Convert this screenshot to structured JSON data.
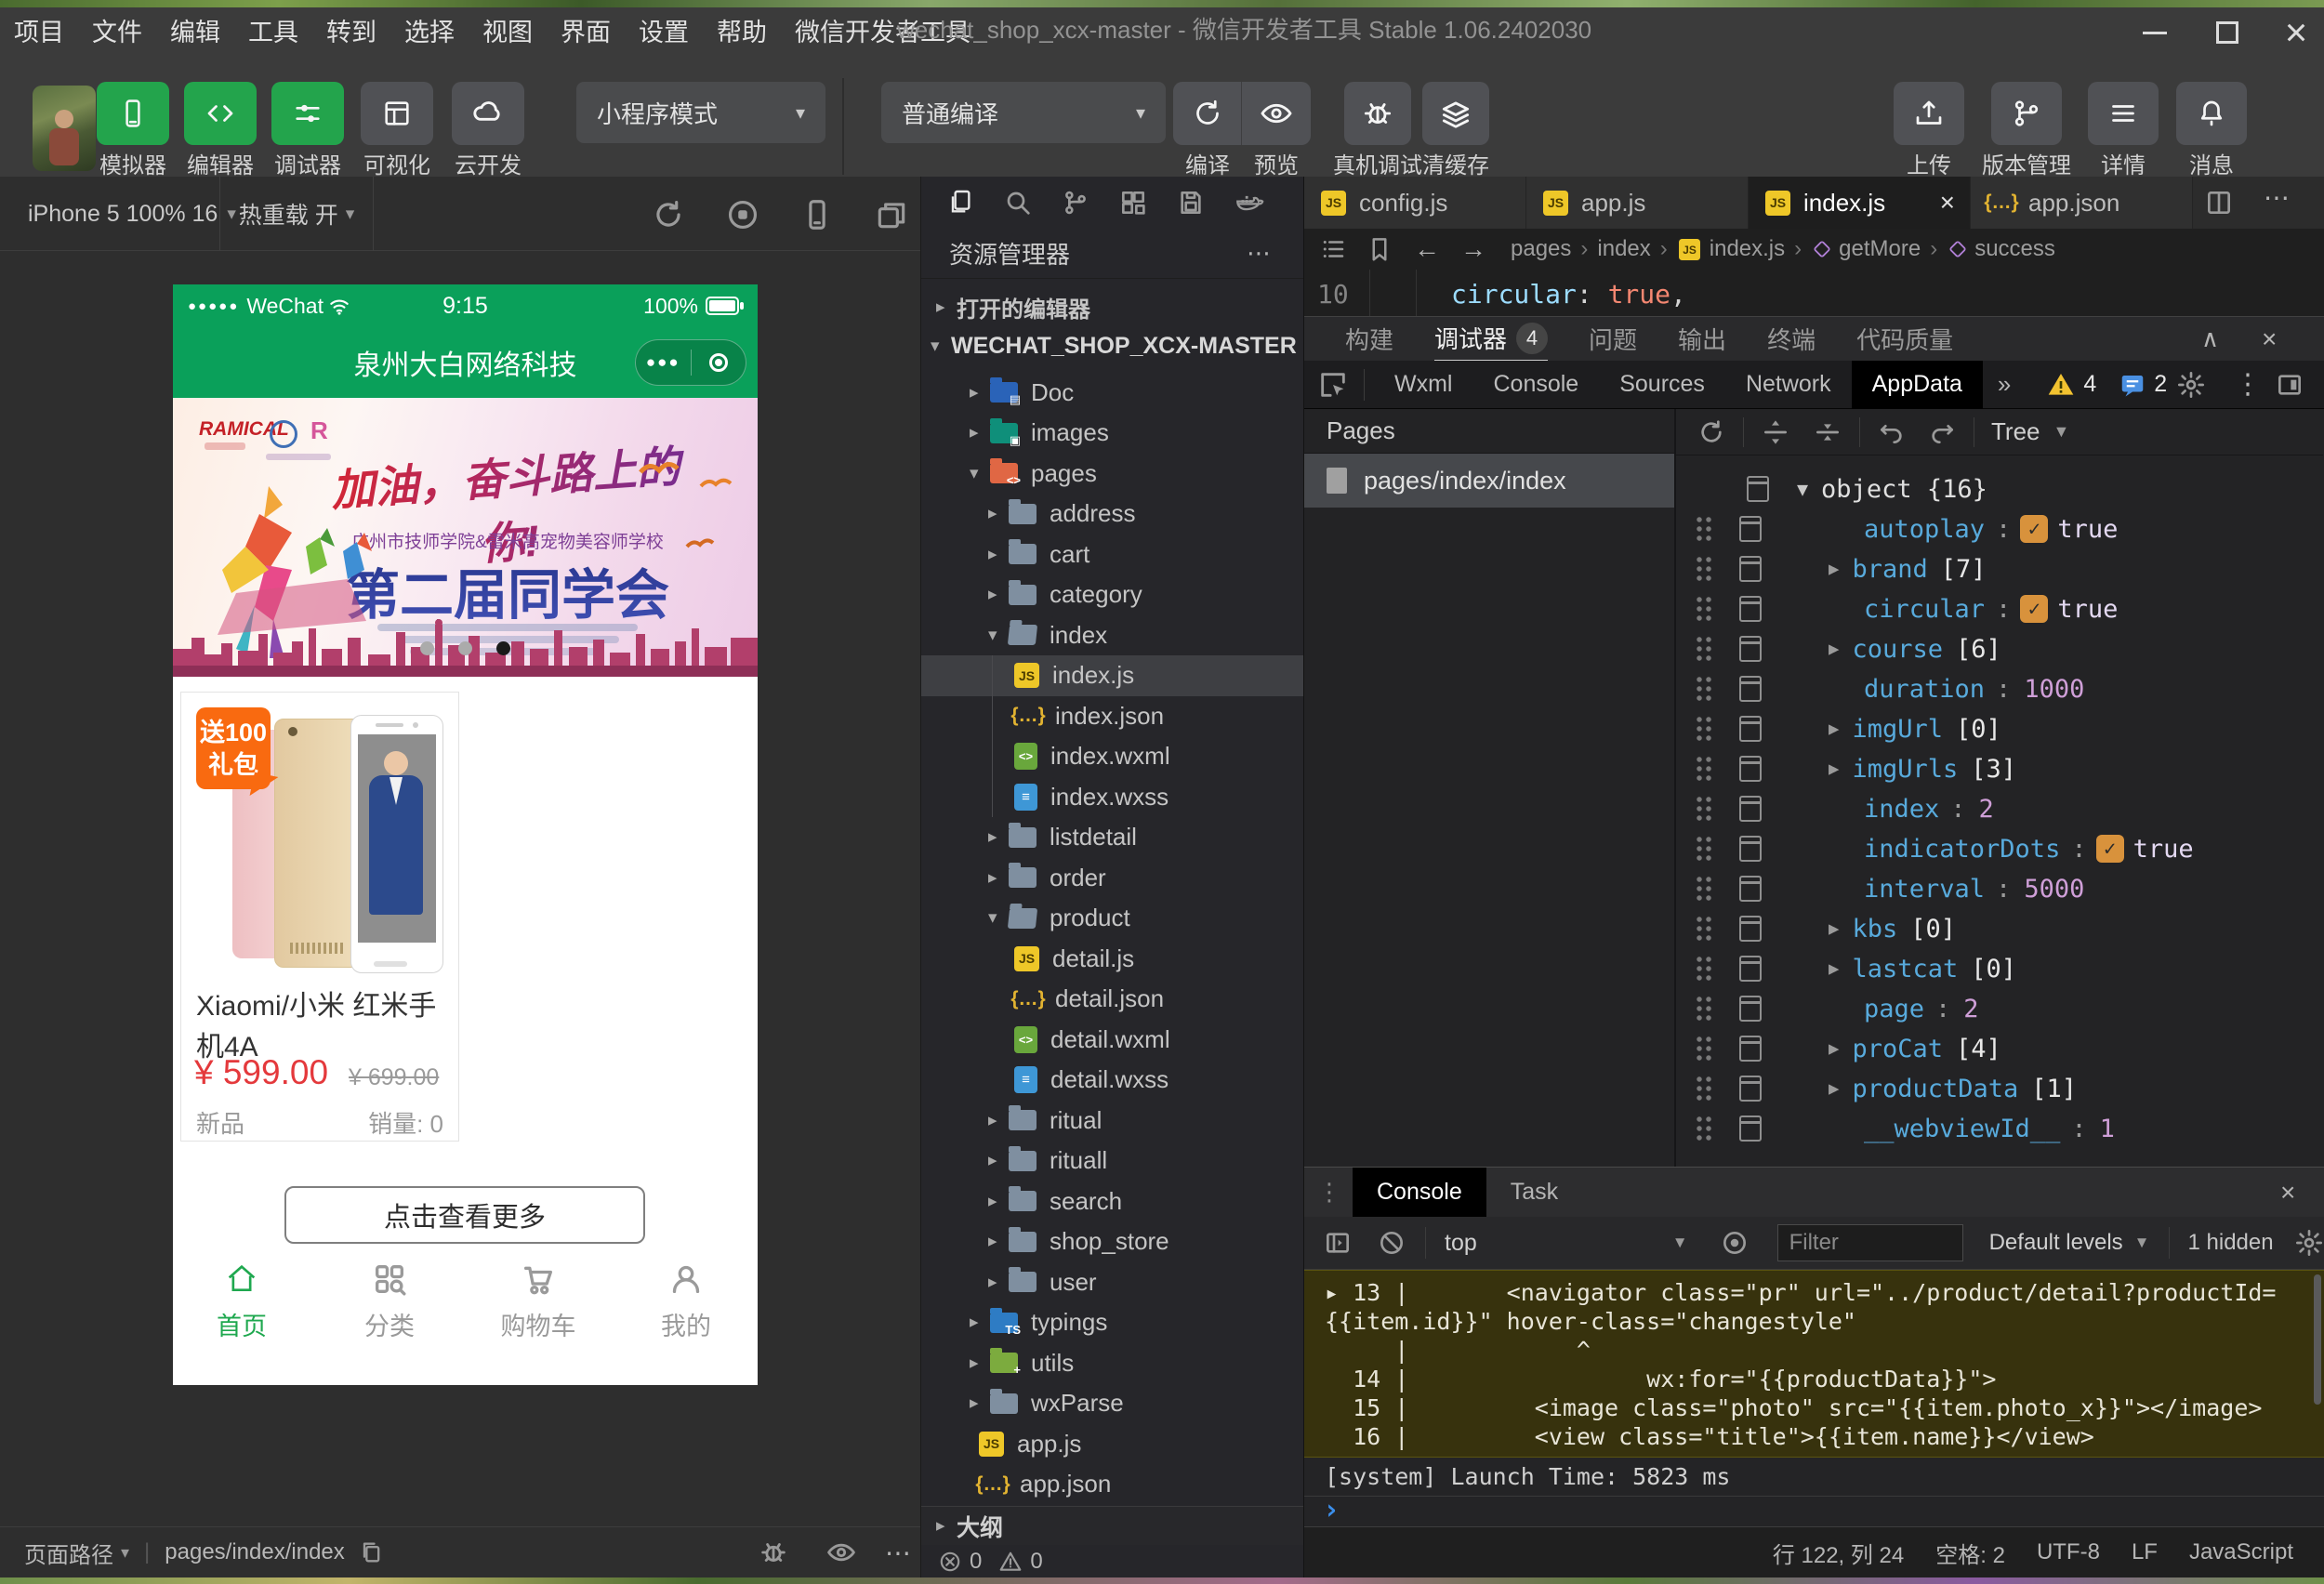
{
  "window": {
    "menu": [
      "项目",
      "文件",
      "编辑",
      "工具",
      "转到",
      "选择",
      "视图",
      "界面",
      "设置",
      "帮助",
      "微信开发者工具"
    ],
    "title": "wechat_shop_xcx-master - 微信开发者工具 Stable 1.06.2402030"
  },
  "toolbar": {
    "mode_buttons": [
      {
        "label": "模拟器",
        "icon": "phone-icon",
        "style": "green"
      },
      {
        "label": "编辑器",
        "icon": "code-icon",
        "style": "green"
      },
      {
        "label": "调试器",
        "icon": "sliders-icon",
        "style": "green"
      },
      {
        "label": "可视化",
        "icon": "layout-icon",
        "style": "gray"
      },
      {
        "label": "云开发",
        "icon": "cloud-icon",
        "style": "gray"
      }
    ],
    "mode_dropdown": "小程序模式",
    "compile_dropdown": "普通编译",
    "action_buttons": [
      {
        "label": "编译",
        "icon": "refresh-icon"
      },
      {
        "label": "预览",
        "icon": "eye-icon"
      },
      {
        "label": "真机调试",
        "icon": "bug-icon"
      },
      {
        "label": "清缓存",
        "icon": "layers-icon"
      }
    ],
    "right_buttons": [
      {
        "label": "上传",
        "icon": "upload-icon"
      },
      {
        "label": "版本管理",
        "icon": "branch-icon"
      },
      {
        "label": "详情",
        "icon": "menu-icon"
      },
      {
        "label": "消息",
        "icon": "bell-icon"
      }
    ]
  },
  "simulator": {
    "device": "iPhone 5 100% 16",
    "hot_reload": "热重载 开",
    "phone": {
      "status": {
        "carrier": "WeChat",
        "time": "9:15",
        "battery": "100%"
      },
      "title": "泉州大白网络科技",
      "banner": {
        "brand": "RAMICAL",
        "headline": "加油，奋斗路上的你!",
        "subtitle": "广州市技师学院&雷米高宠物美容师学校",
        "main_title": "第二届同学会",
        "dots": 3,
        "active_dot": 2
      },
      "product": {
        "badge": [
          "送100",
          "礼包"
        ],
        "name": "Xiaomi/小米 红米手机4A",
        "price": "¥ 599.00",
        "original_price": "¥ 699.00",
        "tag": "新品",
        "sales": "销量:  0"
      },
      "more_button": "点击查看更多",
      "tabbar": [
        {
          "label": "首页",
          "icon": "home-icon",
          "active": true
        },
        {
          "label": "分类",
          "icon": "category-icon",
          "active": false
        },
        {
          "label": "购物车",
          "icon": "cart-icon",
          "active": false
        },
        {
          "label": "我的",
          "icon": "user-icon",
          "active": false
        }
      ]
    },
    "footer": {
      "label": "页面路径",
      "path": "pages/index/index"
    }
  },
  "explorer": {
    "activity_icons": [
      "files-icon",
      "search-icon",
      "source-control-icon",
      "extensions-icon",
      "save-icon",
      "docker-icon"
    ],
    "header": "资源管理器",
    "open_editors": "打开的编辑器",
    "project": "WECHAT_SHOP_XCX-MASTER",
    "tree": [
      {
        "name": "Doc",
        "icon": "folder-doc",
        "arrow": "collapsed",
        "level": 1
      },
      {
        "name": "images",
        "icon": "folder-images",
        "arrow": "collapsed",
        "level": 1
      },
      {
        "name": "pages",
        "icon": "folder-pages",
        "arrow": "expanded",
        "level": 1
      },
      {
        "name": "address",
        "icon": "folder",
        "arrow": "collapsed",
        "level": 2
      },
      {
        "name": "cart",
        "icon": "folder",
        "arrow": "collapsed",
        "level": 2
      },
      {
        "name": "category",
        "icon": "folder",
        "arrow": "collapsed",
        "level": 2
      },
      {
        "name": "index",
        "icon": "folder-open",
        "arrow": "expanded",
        "level": 2
      },
      {
        "name": "index.js",
        "icon": "js",
        "level": 3,
        "selected": true,
        "guide": true
      },
      {
        "name": "index.json",
        "icon": "json",
        "level": 3,
        "guide": true
      },
      {
        "name": "index.wxml",
        "icon": "wxml",
        "level": 3,
        "guide": true
      },
      {
        "name": "index.wxss",
        "icon": "wxss",
        "level": 3,
        "guide": true
      },
      {
        "name": "listdetail",
        "icon": "folder",
        "arrow": "collapsed",
        "level": 2
      },
      {
        "name": "order",
        "icon": "folder",
        "arrow": "collapsed",
        "level": 2
      },
      {
        "name": "product",
        "icon": "folder-open",
        "arrow": "expanded",
        "level": 2
      },
      {
        "name": "detail.js",
        "icon": "js",
        "level": 3
      },
      {
        "name": "detail.json",
        "icon": "json",
        "level": 3
      },
      {
        "name": "detail.wxml",
        "icon": "wxml",
        "level": 3
      },
      {
        "name": "detail.wxss",
        "icon": "wxss",
        "level": 3
      },
      {
        "name": "ritual",
        "icon": "folder",
        "arrow": "collapsed",
        "level": 2
      },
      {
        "name": "rituall",
        "icon": "folder",
        "arrow": "collapsed",
        "level": 2
      },
      {
        "name": "search",
        "icon": "folder",
        "arrow": "collapsed",
        "level": 2
      },
      {
        "name": "shop_store",
        "icon": "folder",
        "arrow": "collapsed",
        "level": 2
      },
      {
        "name": "user",
        "icon": "folder",
        "arrow": "collapsed",
        "level": 2
      },
      {
        "name": "typings",
        "icon": "folder-ts",
        "arrow": "collapsed",
        "level": 1
      },
      {
        "name": "utils",
        "icon": "folder-utils",
        "arrow": "collapsed",
        "level": 1
      },
      {
        "name": "wxParse",
        "icon": "folder",
        "arrow": "collapsed",
        "level": 1
      },
      {
        "name": "app.js",
        "icon": "js",
        "level": 1
      },
      {
        "name": "app.json",
        "icon": "json",
        "level": 1
      }
    ],
    "outline": "大纲",
    "problems": {
      "errors": "0",
      "warnings": "0"
    }
  },
  "editor": {
    "tabs": [
      {
        "name": "config.js",
        "icon": "js",
        "active": false
      },
      {
        "name": "app.js",
        "icon": "js",
        "active": false
      },
      {
        "name": "index.js",
        "icon": "js",
        "active": true,
        "closable": true
      },
      {
        "name": "app.json",
        "icon": "json",
        "active": false
      }
    ],
    "breadcrumb": [
      {
        "label": "pages"
      },
      {
        "label": "index"
      },
      {
        "label": "index.js",
        "icon": "js"
      },
      {
        "label": "getMore",
        "icon": "symbol-icon"
      },
      {
        "label": "success",
        "icon": "symbol-icon"
      }
    ],
    "code_line": {
      "number": "10",
      "key": "circular",
      "colon": ": ",
      "value": "true",
      "comma": ","
    }
  },
  "debug": {
    "tabs": [
      {
        "label": "构建"
      },
      {
        "label": "调试器",
        "badge": "4",
        "active": true
      },
      {
        "label": "问题"
      },
      {
        "label": "输出"
      },
      {
        "label": "终端"
      },
      {
        "label": "代码质量"
      }
    ],
    "devtools_tabs": [
      {
        "label": "Wxml"
      },
      {
        "label": "Console"
      },
      {
        "label": "Sources"
      },
      {
        "label": "Network"
      },
      {
        "label": "AppData",
        "active": true
      }
    ],
    "warning_count": "4",
    "message_count": "2",
    "pages": {
      "title": "Pages",
      "selected": "pages/index/index"
    },
    "appdata": {
      "view": "Tree",
      "root": "object {16}",
      "entries": [
        {
          "key": "autoplay",
          "kind": "bool",
          "value": "true"
        },
        {
          "key": "brand",
          "kind": "array",
          "value": "[7]"
        },
        {
          "key": "circular",
          "kind": "bool",
          "value": "true"
        },
        {
          "key": "course",
          "kind": "array",
          "value": "[6]"
        },
        {
          "key": "duration",
          "kind": "number",
          "value": "1000"
        },
        {
          "key": "imgUrl",
          "kind": "array",
          "value": "[0]"
        },
        {
          "key": "imgUrls",
          "kind": "array",
          "value": "[3]"
        },
        {
          "key": "index",
          "kind": "number",
          "value": "2"
        },
        {
          "key": "indicatorDots",
          "kind": "bool",
          "value": "true"
        },
        {
          "key": "interval",
          "kind": "number",
          "value": "5000"
        },
        {
          "key": "kbs",
          "kind": "array",
          "value": "[0]"
        },
        {
          "key": "lastcat",
          "kind": "array",
          "value": "[0]"
        },
        {
          "key": "page",
          "kind": "number",
          "value": "2"
        },
        {
          "key": "proCat",
          "kind": "array",
          "value": "[4]"
        },
        {
          "key": "productData",
          "kind": "array",
          "value": "[1]"
        },
        {
          "key": "__webviewId__",
          "kind": "number",
          "value": "1"
        }
      ]
    }
  },
  "console": {
    "tabs": [
      {
        "label": "Console",
        "active": true
      },
      {
        "label": "Task",
        "active": false
      }
    ],
    "context": "top",
    "filter_placeholder": "Filter",
    "levels": "Default levels",
    "hidden": "1 hidden",
    "warning_lines": [
      "▸ 13 |       <navigator class=\"pr\" url=\"../product/detail?productId=",
      "{{item.id}}\" hover-class=\"changestyle\"",
      "     |            ^",
      "  14 |                 wx:for=\"{{productData}}\">",
      "  15 |         <image class=\"photo\" src=\"{{item.photo_x}}\"></image>",
      "  16 |         <view class=\"title\">{{item.name}}</view>"
    ],
    "system_line": "[system] Launch Time: 5823 ms",
    "prompt": "›"
  },
  "statusbar": {
    "items": [
      "行 122, 列 24",
      "空格: 2",
      "UTF-8",
      "LF",
      "JavaScript"
    ]
  }
}
